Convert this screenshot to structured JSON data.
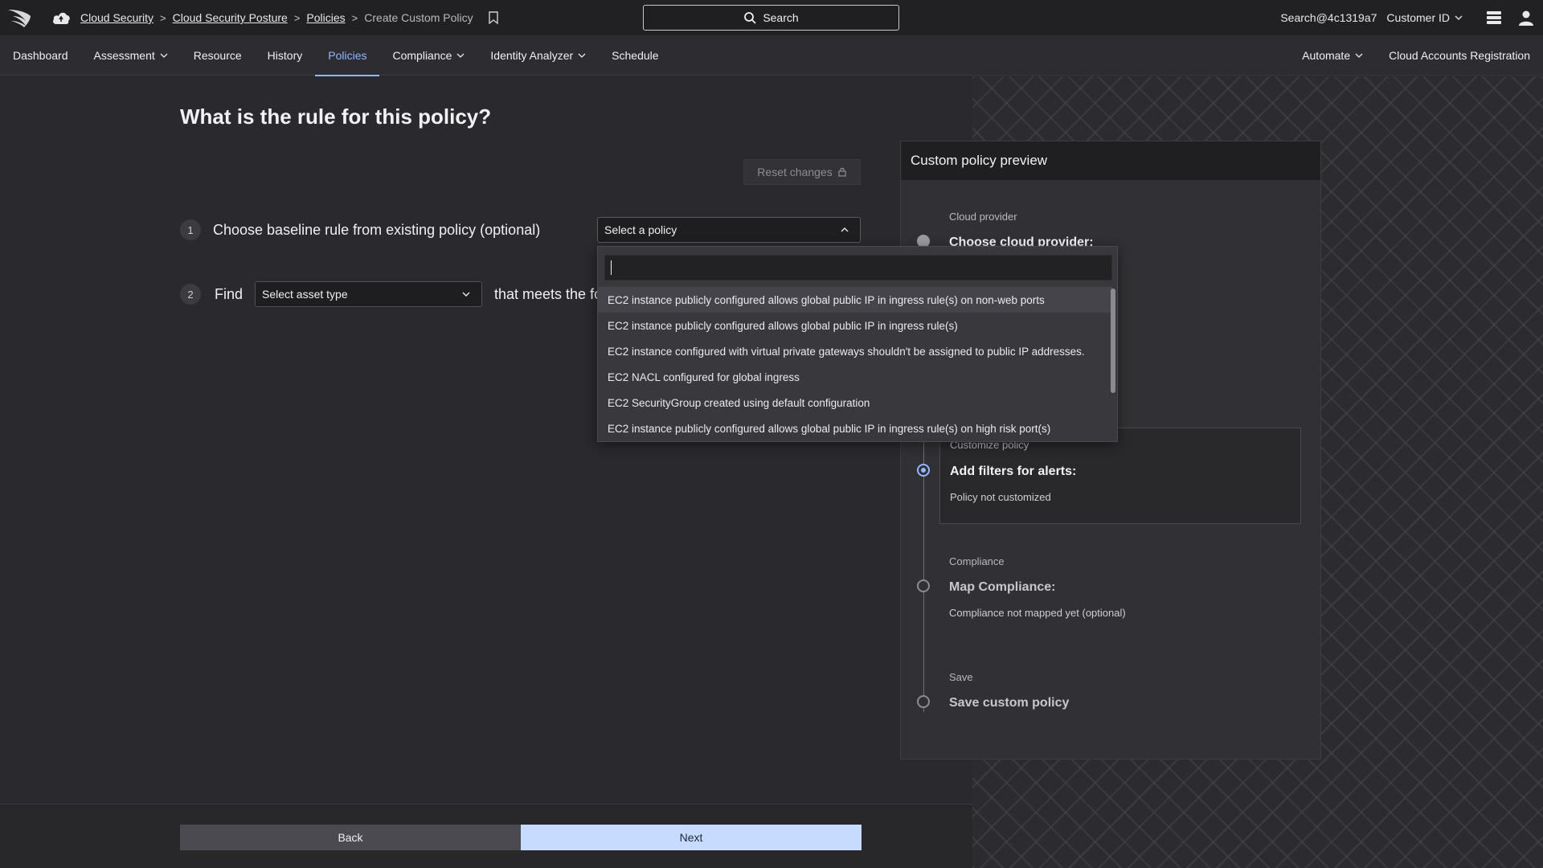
{
  "topbar": {
    "breadcrumb": {
      "items": [
        "Cloud Security",
        "Cloud Security Posture",
        "Policies"
      ],
      "current": "Create Custom Policy",
      "separator": ">"
    },
    "search_label": "Search",
    "user": "Search@4c1319a7",
    "customer": "Customer ID"
  },
  "nav": {
    "left": [
      {
        "label": "Dashboard"
      },
      {
        "label": "Assessment"
      },
      {
        "label": "Resource"
      },
      {
        "label": "History"
      },
      {
        "label": "Policies"
      },
      {
        "label": "Compliance"
      },
      {
        "label": "Identity Analyzer"
      },
      {
        "label": "Schedule"
      }
    ],
    "right": [
      {
        "label": "Automate"
      },
      {
        "label": "Cloud Accounts Registration"
      }
    ],
    "active": "Policies"
  },
  "main": {
    "title": "What is the rule for this policy?",
    "reset_label": "Reset changes",
    "step1": {
      "num": "1",
      "label": "Choose baseline rule from existing policy (optional)",
      "select_value": "Select a policy"
    },
    "step2": {
      "num": "2",
      "label": "Find",
      "select_value": "Select asset type",
      "suffix": "that meets the fo"
    },
    "dropdown": {
      "search_value": "",
      "options": [
        "EC2 instance publicly configured allows global public IP in ingress rule(s) on non-web ports",
        "EC2 instance publicly configured allows global public IP in ingress rule(s)",
        "EC2 instance configured with virtual private gateways shouldn't be assigned to public IP addresses.",
        "EC2 NACL configured for global ingress",
        "EC2 SecurityGroup created using default configuration",
        "EC2 instance publicly configured allows global public IP in ingress rule(s) on high risk port(s)"
      ]
    }
  },
  "preview": {
    "title": "Custom policy preview",
    "steps": [
      {
        "small": "Cloud provider",
        "big": "Choose cloud provider:",
        "sub": ""
      },
      {
        "small": "Customize policy",
        "big": "Add filters for alerts:",
        "sub": "Policy not customized"
      },
      {
        "small": "Compliance",
        "big": "Map Compliance:",
        "sub": "Compliance not mapped yet (optional)"
      },
      {
        "small": "Save",
        "big": "Save custom policy",
        "sub": ""
      }
    ]
  },
  "footer": {
    "back_label": "Back",
    "next_label": "Next"
  },
  "colors": {
    "accent": "#8fb8ff",
    "next_button": "#c5dbff",
    "background": "#2a2a2e",
    "topbar": "#212124"
  }
}
